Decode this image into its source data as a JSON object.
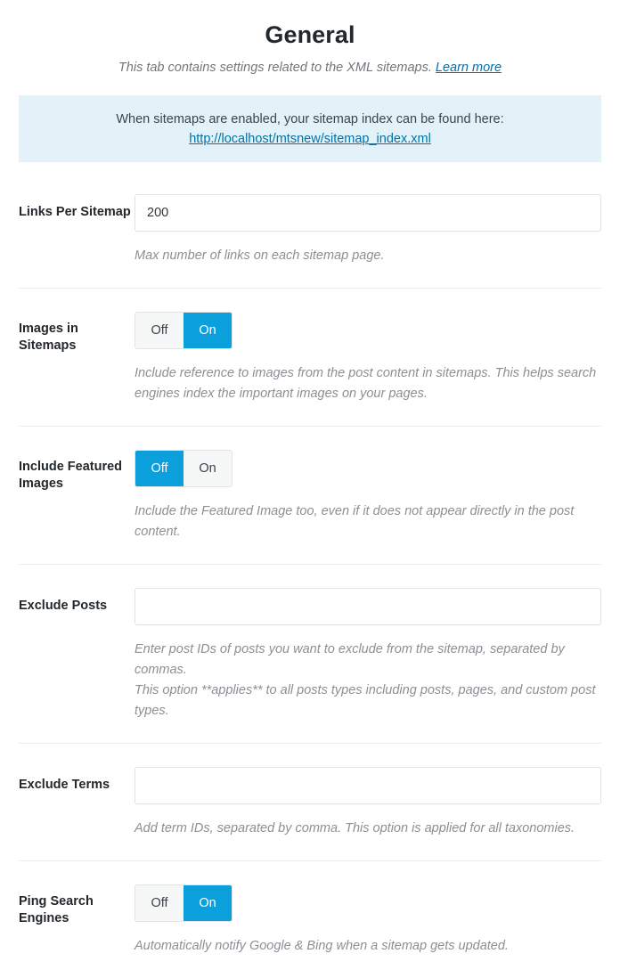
{
  "header": {
    "title": "General",
    "subtitle": "This tab contains settings related to the XML sitemaps.",
    "learn_more_label": "Learn more"
  },
  "notice": {
    "text": "When sitemaps are enabled, your sitemap index can be found here:",
    "url": "http://localhost/mtsnew/sitemap_index.xml"
  },
  "colors": {
    "accent": "#0b9fdb",
    "link": "#0073aa",
    "notice_bg": "#e3f2f9",
    "help_text": "#8c8f94",
    "divider": "#ececec"
  },
  "toggle_labels": {
    "off": "Off",
    "on": "On"
  },
  "rows": [
    {
      "label": "Links Per Sitemap",
      "type": "text",
      "value": "200",
      "placeholder": "",
      "help": [
        "Max number of links on each sitemap page."
      ]
    },
    {
      "label": "Images in Sitemaps",
      "type": "toggle",
      "off_label": "Off",
      "on_label": "On",
      "selected": "On",
      "help": [
        "Include reference to images from the post content in sitemaps. This helps search engines index the important images on your pages."
      ]
    },
    {
      "label": "Include Featured Images",
      "type": "toggle",
      "off_label": "Off",
      "on_label": "On",
      "selected": "Off",
      "help": [
        "Include the Featured Image too, even if it does not appear directly in the post content."
      ]
    },
    {
      "label": "Exclude Posts",
      "type": "text",
      "value": "",
      "placeholder": "",
      "help": [
        "Enter post IDs of posts you want to exclude from the sitemap, separated by commas.",
        "This option **applies** to all posts types including posts, pages, and custom post types."
      ]
    },
    {
      "label": "Exclude Terms",
      "type": "text",
      "value": "",
      "placeholder": "",
      "help": [
        "Add term IDs, separated by comma. This option is applied for all taxonomies."
      ]
    },
    {
      "label": "Ping Search Engines",
      "type": "toggle",
      "off_label": "Off",
      "on_label": "On",
      "selected": "On",
      "help": [
        "Automatically notify Google & Bing when a sitemap gets updated."
      ]
    }
  ]
}
